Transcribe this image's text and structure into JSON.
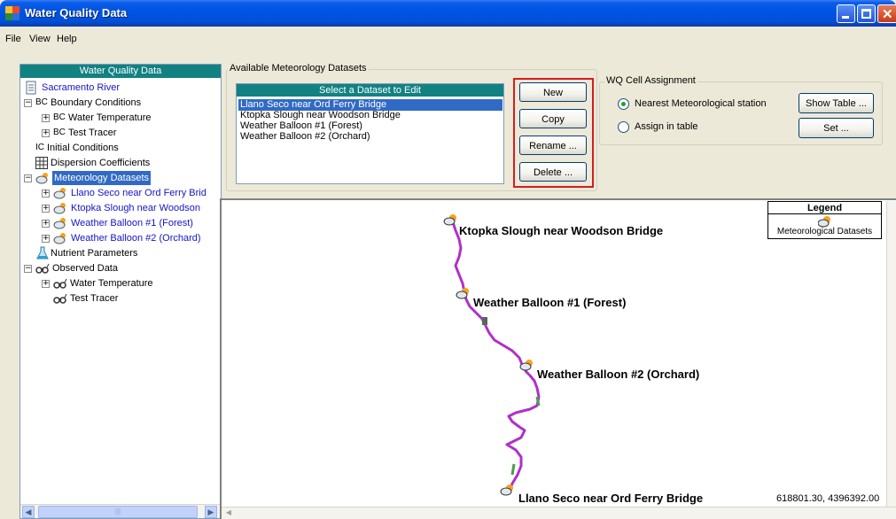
{
  "window": {
    "title": "Water Quality Data"
  },
  "menu": [
    "File",
    "View",
    "Help"
  ],
  "tree": {
    "header": "Water Quality Data",
    "root": "Sacramento River",
    "boundary_prefix": "BC",
    "boundary_label": "Boundary Conditions",
    "bc_water_temp": "Water Temperature",
    "bc_test_tracer": "Test Tracer",
    "ic_prefix": "IC",
    "initial_conditions": "Initial Conditions",
    "dispersion": "Dispersion Coefficients",
    "meteorology": "Meteorology Datasets",
    "met_items": [
      "Llano Seco near Ord Ferry Brid",
      "Ktopka Slough near Woodson",
      "Weather Balloon #1 (Forest)",
      "Weather Balloon #2 (Orchard)"
    ],
    "nutrient": "Nutrient Parameters",
    "observed": "Observed Data",
    "obs_water_temp": "Water Temperature",
    "obs_test_tracer": "Test Tracer"
  },
  "meteorology_panel": {
    "group_label": "Available Meteorology Datasets",
    "list_header": "Select a Dataset to Edit",
    "items": [
      "Llano Seco near Ord Ferry Bridge",
      "Ktopka Slough near Woodson Bridge",
      "Weather Balloon #1 (Forest)",
      "Weather Balloon #2 (Orchard)"
    ],
    "selected_index": 0,
    "buttons": {
      "new": "New",
      "copy": "Copy",
      "rename": "Rename ...",
      "delete": "Delete ..."
    }
  },
  "wq_cell": {
    "group_label": "WQ Cell Assignment",
    "option_nearest": "Nearest Meteorological station",
    "option_table": "Assign in table",
    "selected": "nearest",
    "show_table_button": "Show Table ...",
    "set_button": "Set ..."
  },
  "map": {
    "legend_title": "Legend",
    "legend_item": "Meteorological Datasets",
    "stations": [
      "Ktopka Slough near Woodson Bridge",
      "Weather Balloon #1 (Forest)",
      "Weather Balloon #2 (Orchard)",
      "Llano Seco near Ord Ferry Bridge"
    ],
    "coordinates": "618801.30, 4396392.00",
    "river_color": "#b030c8",
    "river_segment_color": "#4f9a4f"
  },
  "colors": {
    "header_teal": "#128182",
    "selection_blue": "#316ac5",
    "highlight_red": "#d81c1c",
    "link_blue": "#1414c8"
  }
}
